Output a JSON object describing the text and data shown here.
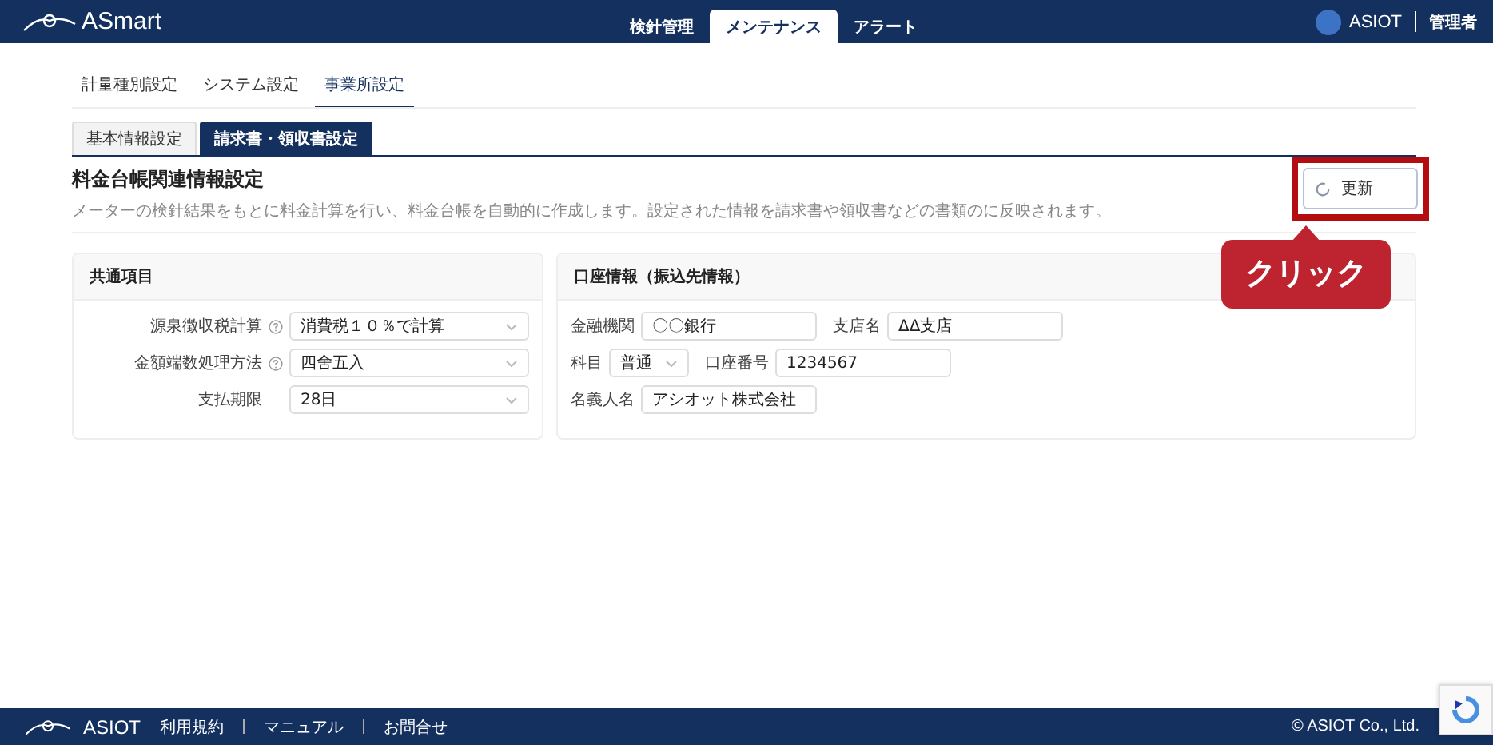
{
  "header": {
    "logo": "ASmart",
    "tabs": [
      {
        "label": "検針管理",
        "selected": false
      },
      {
        "label": "メンテナンス",
        "selected": true
      },
      {
        "label": "アラート",
        "selected": false
      }
    ],
    "company": "ASIOT",
    "user": "管理者"
  },
  "subnav": [
    {
      "label": "計量種別設定",
      "selected": false
    },
    {
      "label": "システム設定",
      "selected": false
    },
    {
      "label": "事業所設定",
      "selected": true
    }
  ],
  "tabs": [
    {
      "label": "基本情報設定",
      "selected": false
    },
    {
      "label": "請求書・領収書設定",
      "selected": true
    }
  ],
  "page": {
    "title": "料金台帳関連情報設定",
    "description": "メーターの検針結果をもとに料金計算を行い、料金台帳を自動的に作成します。設定された情報を請求書や領収書などの書類のに反映されます。",
    "update_button": "更新",
    "callout": "クリック"
  },
  "common": {
    "title": "共通項目",
    "rows": [
      {
        "label": "源泉徴収税計算",
        "help": true,
        "value": "消費税１０％で計算"
      },
      {
        "label": "金額端数処理方法",
        "help": true,
        "value": "四舍五入"
      },
      {
        "label": "支払期限",
        "help": false,
        "value": "28日"
      }
    ]
  },
  "account": {
    "title": "口座情報（振込先情報）",
    "rows": [
      [
        {
          "label": "金融機関",
          "value": "〇〇銀行",
          "kind": "input"
        },
        {
          "label": "支店名",
          "value": "ΔΔ支店",
          "kind": "input"
        }
      ],
      [
        {
          "label": "科目",
          "value": "普通",
          "kind": "select"
        },
        {
          "label": "口座番号",
          "value": "1234567",
          "kind": "input"
        }
      ],
      [
        {
          "label": "名義人名",
          "value": "アシオット株式会社",
          "kind": "input"
        }
      ]
    ]
  },
  "footer": {
    "logo": "ASIOT",
    "links": [
      "利用規約",
      "マニュアル",
      "お問合せ"
    ],
    "copyright": "© ASIOT Co., Ltd."
  }
}
